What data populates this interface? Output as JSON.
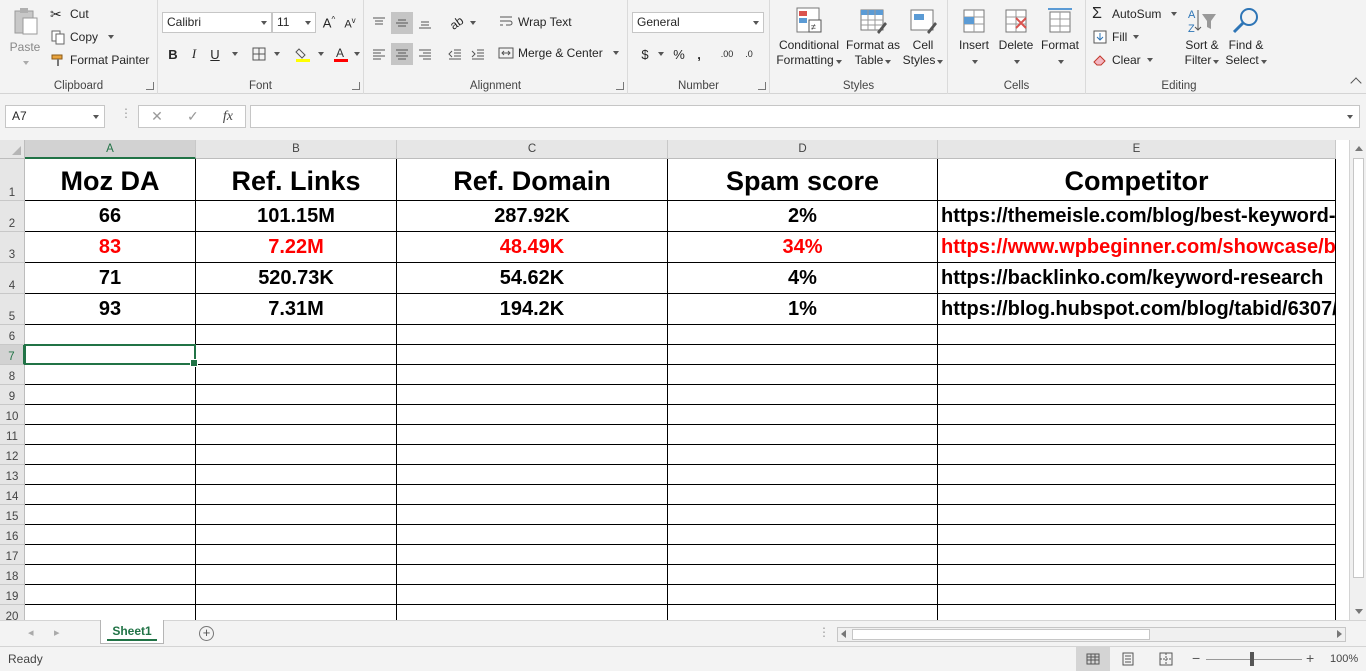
{
  "ribbon": {
    "clipboard": {
      "label": "Clipboard",
      "paste": "Paste",
      "cut": "Cut",
      "copy": "Copy",
      "format_painter": "Format Painter"
    },
    "font": {
      "label": "Font",
      "font_name": "Calibri",
      "font_size": "11",
      "bold": "B",
      "italic": "I",
      "underline": "U"
    },
    "alignment": {
      "label": "Alignment",
      "wrap_text": "Wrap Text",
      "merge_center": "Merge & Center"
    },
    "number": {
      "label": "Number",
      "format": "General",
      "currency": "$",
      "percent": "%",
      "comma": ",",
      "inc_decimal": ".00",
      "dec_decimal": ".0"
    },
    "styles": {
      "label": "Styles",
      "conditional_1": "Conditional",
      "conditional_2": "Formatting",
      "format_table_1": "Format as",
      "format_table_2": "Table",
      "cell_styles_1": "Cell",
      "cell_styles_2": "Styles"
    },
    "cells": {
      "label": "Cells",
      "insert": "Insert",
      "delete": "Delete",
      "format": "Format"
    },
    "editing": {
      "label": "Editing",
      "autosum": "AutoSum",
      "fill": "Fill",
      "clear": "Clear",
      "sort_1": "Sort &",
      "sort_2": "Filter",
      "find_1": "Find &",
      "find_2": "Select"
    }
  },
  "formula_bar": {
    "name_box": "A7",
    "fx": "fx",
    "cancel": "✕",
    "enter": "✓",
    "value": ""
  },
  "sheet": {
    "columns": [
      "A",
      "B",
      "C",
      "D",
      "E"
    ],
    "rows": [
      "1",
      "2",
      "3",
      "4",
      "5",
      "6",
      "7",
      "8",
      "9",
      "10",
      "11",
      "12",
      "13",
      "14",
      "15",
      "16",
      "17",
      "18",
      "19",
      "20"
    ],
    "headers": [
      "Moz DA",
      "Ref. Links",
      "Ref. Domain",
      "Spam score",
      "Competitor"
    ],
    "data": [
      [
        "66",
        "101.15M",
        "287.92K",
        "2%",
        "https://themeisle.com/blog/best-keyword-research-tools/"
      ],
      [
        "83",
        "7.22M",
        "48.49K",
        "34%",
        "https://www.wpbeginner.com/showcase/best-keyword-research-tools/"
      ],
      [
        "71",
        "520.73K",
        "54.62K",
        "4%",
        "https://backlinko.com/keyword-research"
      ],
      [
        "93",
        "7.31M",
        "194.2K",
        "1%",
        "https://blog.hubspot.com/blog/tabid/6307/"
      ]
    ],
    "highlight_color": "#ff0000",
    "tab_name": "Sheet1"
  },
  "status": {
    "text": "Ready",
    "zoom": "100%"
  },
  "colors": {
    "excel_green": "#217346"
  }
}
